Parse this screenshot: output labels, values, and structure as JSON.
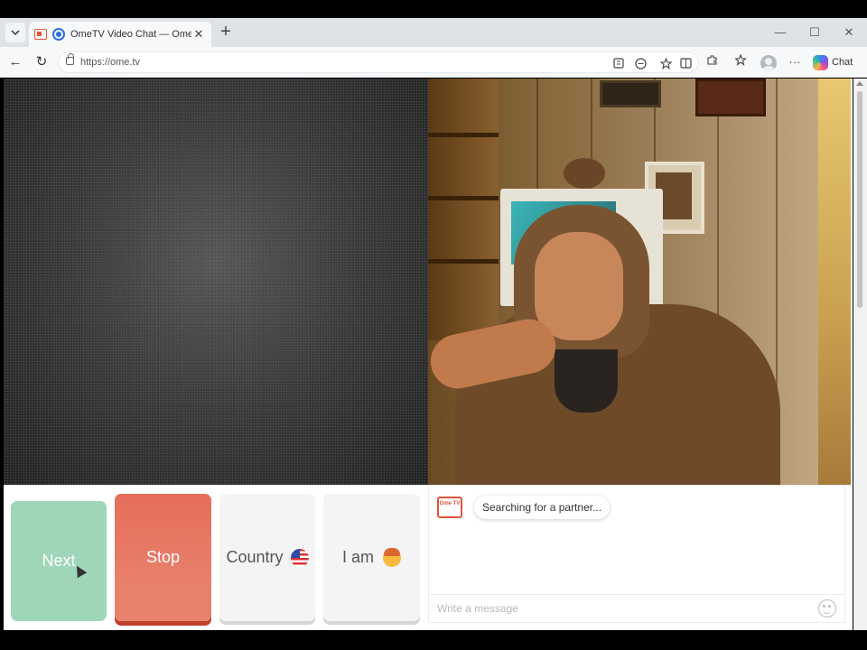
{
  "browser": {
    "tab": {
      "title": "OmeTV Video Chat — Omeg",
      "close_glyph": "✕"
    },
    "new_tab_glyph": "+",
    "window": {
      "minimize": "—",
      "maximize": "☐",
      "close": "✕"
    },
    "nav": {
      "back": "←",
      "refresh": "↻"
    },
    "url": "https://ome.tv",
    "copilot_label": "Chat",
    "more_glyph": "···"
  },
  "controls": {
    "next_label": "Next",
    "stop_label": "Stop",
    "country_label": "Country",
    "iam_label": "I am"
  },
  "chat": {
    "logo_text": "Ome TV",
    "status_message": "Searching for a partner...",
    "input_placeholder": "Write a message"
  },
  "colors": {
    "next": "#9fd6b7",
    "stop": "#e66e5a",
    "accent": "#e0553b"
  }
}
